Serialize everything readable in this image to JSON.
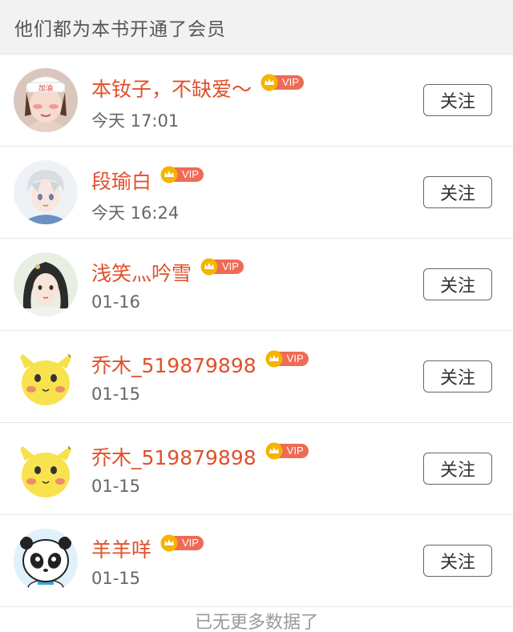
{
  "header": {
    "title": "他们都为本书开通了会员"
  },
  "vip_label": "VIP",
  "follow_label": "关注",
  "footer": {
    "text": "已无更多数据了"
  },
  "colors": {
    "name": "#e0502a",
    "vip_badge": "#ef6b55",
    "crown": "#f5b400"
  },
  "members": [
    {
      "name": "本钕子，不缺爱～",
      "time": "今天 17:01",
      "avatar": "girl-photo-avatar"
    },
    {
      "name": "段瑜白",
      "time": "今天 16:24",
      "avatar": "anime-boy-avatar"
    },
    {
      "name": "浅笑灬吟雪",
      "time": "01-16",
      "avatar": "anime-girl-avatar"
    },
    {
      "name": "乔木_519879898",
      "time": "01-15",
      "avatar": "pikachu-avatar"
    },
    {
      "name": "乔木_519879898",
      "time": "01-15",
      "avatar": "pikachu-avatar"
    },
    {
      "name": "羊羊咩",
      "time": "01-15",
      "avatar": "panda-avatar"
    }
  ]
}
